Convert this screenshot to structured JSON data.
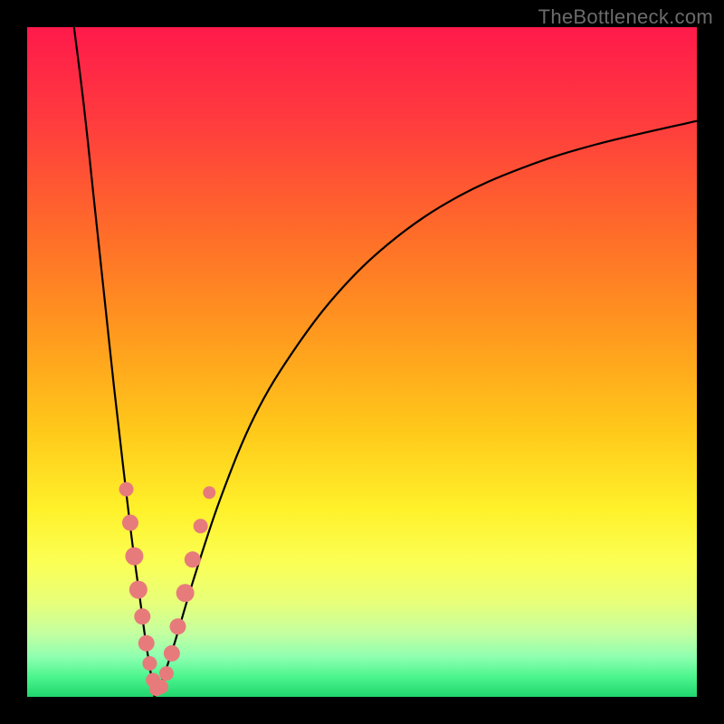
{
  "watermark": "TheBottleneck.com",
  "gradient": {
    "stops": [
      {
        "offset": 0.0,
        "color": "#ff1a4b"
      },
      {
        "offset": 0.14,
        "color": "#ff3b3e"
      },
      {
        "offset": 0.3,
        "color": "#ff6a2a"
      },
      {
        "offset": 0.46,
        "color": "#ff9a1e"
      },
      {
        "offset": 0.6,
        "color": "#ffc81a"
      },
      {
        "offset": 0.72,
        "color": "#fff12a"
      },
      {
        "offset": 0.8,
        "color": "#fbff55"
      },
      {
        "offset": 0.86,
        "color": "#e7ff7a"
      },
      {
        "offset": 0.905,
        "color": "#c4ffa0"
      },
      {
        "offset": 0.94,
        "color": "#8fffb0"
      },
      {
        "offset": 0.97,
        "color": "#4cf58e"
      },
      {
        "offset": 1.0,
        "color": "#20d66e"
      }
    ]
  },
  "chart_data": {
    "type": "line",
    "title": "",
    "xlabel": "",
    "ylabel": "",
    "xlim": [
      0,
      100
    ],
    "ylim": [
      0,
      100
    ],
    "x_optimum": 19,
    "series": [
      {
        "name": "left-branch",
        "x": [
          7.0,
          8.5,
          10.0,
          11.5,
          13.0,
          14.5,
          15.7,
          16.8,
          17.6,
          18.3,
          18.8,
          19.0
        ],
        "y": [
          100,
          88,
          74,
          60,
          46,
          33,
          23,
          15,
          9,
          4.5,
          1.5,
          0.0
        ]
      },
      {
        "name": "right-branch",
        "x": [
          19.0,
          20.0,
          22.0,
          25.0,
          29.0,
          34.0,
          40.0,
          47.0,
          55.0,
          64.0,
          74.0,
          85.0,
          100.0
        ],
        "y": [
          0.0,
          2.0,
          8.0,
          18.0,
          30.0,
          42.0,
          52.0,
          61.0,
          68.5,
          74.5,
          79.0,
          82.5,
          86.0
        ]
      }
    ],
    "scatter": {
      "name": "data-points",
      "color": "#e77b7b",
      "points": [
        {
          "x": 14.8,
          "y": 31,
          "r": 8
        },
        {
          "x": 15.4,
          "y": 26,
          "r": 9
        },
        {
          "x": 16.0,
          "y": 21,
          "r": 10
        },
        {
          "x": 16.6,
          "y": 16,
          "r": 10
        },
        {
          "x": 17.2,
          "y": 12,
          "r": 9
        },
        {
          "x": 17.8,
          "y": 8,
          "r": 9
        },
        {
          "x": 18.3,
          "y": 5,
          "r": 8
        },
        {
          "x": 18.8,
          "y": 2.5,
          "r": 8
        },
        {
          "x": 19.3,
          "y": 1.2,
          "r": 8
        },
        {
          "x": 20.0,
          "y": 1.5,
          "r": 8
        },
        {
          "x": 20.8,
          "y": 3.5,
          "r": 8
        },
        {
          "x": 21.6,
          "y": 6.5,
          "r": 9
        },
        {
          "x": 22.5,
          "y": 10.5,
          "r": 9
        },
        {
          "x": 23.6,
          "y": 15.5,
          "r": 10
        },
        {
          "x": 24.7,
          "y": 20.5,
          "r": 9
        },
        {
          "x": 25.9,
          "y": 25.5,
          "r": 8
        },
        {
          "x": 27.2,
          "y": 30.5,
          "r": 7
        }
      ]
    }
  }
}
